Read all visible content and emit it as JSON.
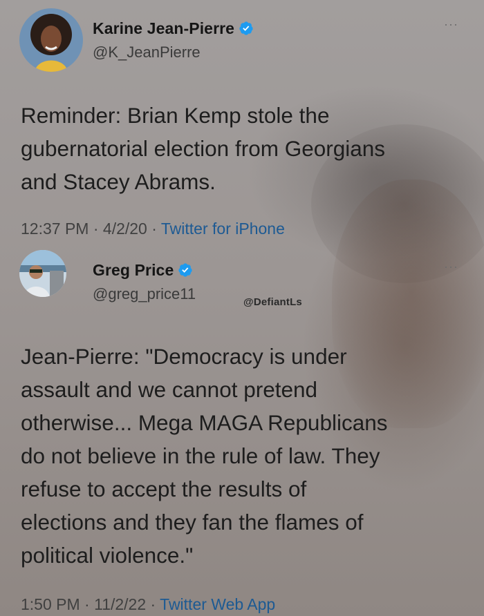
{
  "tweet1": {
    "author_name": "Karine Jean-Pierre",
    "handle": "@K_JeanPierre",
    "text": "Reminder: Brian Kemp stole the\ngubernatorial election from  Georgians\nand Stacey Abrams.",
    "time": "12:37 PM",
    "date": "4/2/20",
    "app": "Twitter for iPhone",
    "more_icon": "···"
  },
  "tweet2": {
    "author_name": "Greg Price",
    "handle": "@greg_price11",
    "text": "Jean-Pierre: \"Democracy is under\nassault and we cannot pretend\notherwise... Mega MAGA Republicans\ndo not believe in the rule of law. They\nrefuse to accept the results of\nelections and they fan the flames of\npolitical violence.\"",
    "time": "1:50 PM",
    "date": "11/2/22",
    "app": "Twitter Web App",
    "more_icon": "···"
  },
  "watermark": "@DefiantLs",
  "separator": " · ",
  "colors": {
    "verified_badge": "#1d9bf0",
    "link_blue": "#1d5a93",
    "background": "#9b9592"
  },
  "icons": {
    "verified": "verified-badge-icon",
    "more": "more-options-icon"
  }
}
